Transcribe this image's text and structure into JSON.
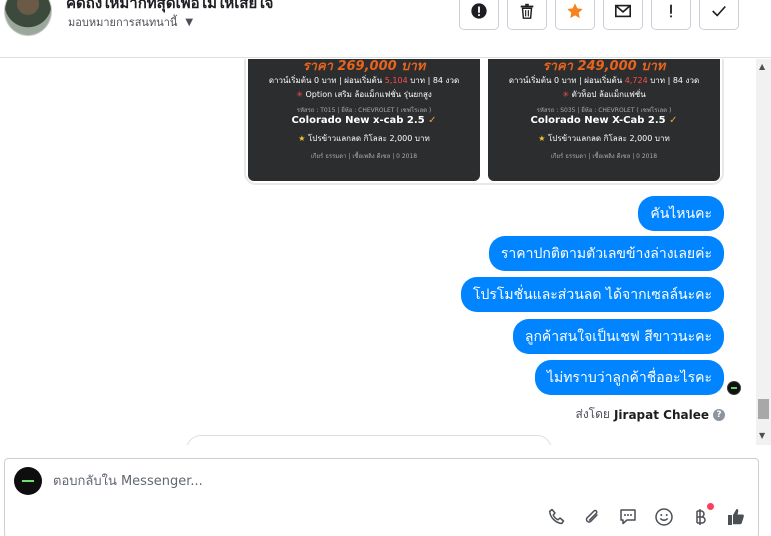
{
  "header": {
    "contact_name": "คิดถึงให้มากที่สุดเพื่อไม่ให้เสียใจ",
    "assign_label": "มอบหมายการสนทนานี้",
    "actions": [
      "spam",
      "delete",
      "star",
      "mark-unread",
      "follow-up",
      "done"
    ]
  },
  "card": {
    "left": {
      "price": "ราคา 269,000 บาท",
      "line1_pre": "ดาวน์เริ่มต้น 0 บาท | ผ่อนเริ่มต้น",
      "line1_hl": "5,104",
      "line1_post": "บาท | 84 งวด",
      "option": "Option เสริม ล้อแม็กแฟชั่น รุ่นยกสูง",
      "meta": "รหัสรถ : T015 | ยี่ห้อ : CHEVROLET ( เชฟโรเลต )",
      "title": "Colorado New x-cab 2.5",
      "promo": "โปรข้าวแลกลด กิโลละ 2,000 บาท",
      "specs": "เกียร์ ธรรมดา | เชื้อเพลิง ดีเซล | 0 2018"
    },
    "right": {
      "price": "ราคา 249,000 บาท",
      "line1_pre": "ดาวน์เริ่มต้น 0 บาท | ผ่อนเริ่มต้น",
      "line1_hl": "4,724",
      "line1_post": "บาท | 84 งวด",
      "option": "ตัวท็อป ล้อแม็กแฟชั่น",
      "meta": "รหัสรถ : S035 | ยี่ห้อ : CHEVROLET ( เชฟโรเลต )",
      "title": "Colorado New X-Cab 2.5",
      "promo": "โปรข้าวแลกลด กิโลละ 2,000 บาท",
      "specs": "เกียร์ ธรรมดา | เชื้อเพลิง ดีเซล | 0 2018"
    }
  },
  "messages": [
    "คันไหนคะ",
    "ราคาปกติตามตัวเลขข้างล่างเลยค่ะ",
    "โปรโมชั่นและส่วนลด ได้จากเซลล์นะคะ",
    "ลูกค้าสนใจเป็นเชฟ สีขาวนะคะ",
    "ไม่ทราบว่าลูกค้าชื่ออะไรคะ"
  ],
  "sent_by": {
    "prefix": "ส่งโดย",
    "name": "Jirapat Chalee",
    "help": "?"
  },
  "composer": {
    "placeholder": "ตอบกลับใน Messenger...",
    "tools": [
      "phone",
      "attachment",
      "saved-replies",
      "emoji",
      "payment",
      "like"
    ]
  },
  "colors": {
    "bubble": "#0084ff",
    "price": "#e9641c",
    "notification": "#fa3e5b"
  }
}
